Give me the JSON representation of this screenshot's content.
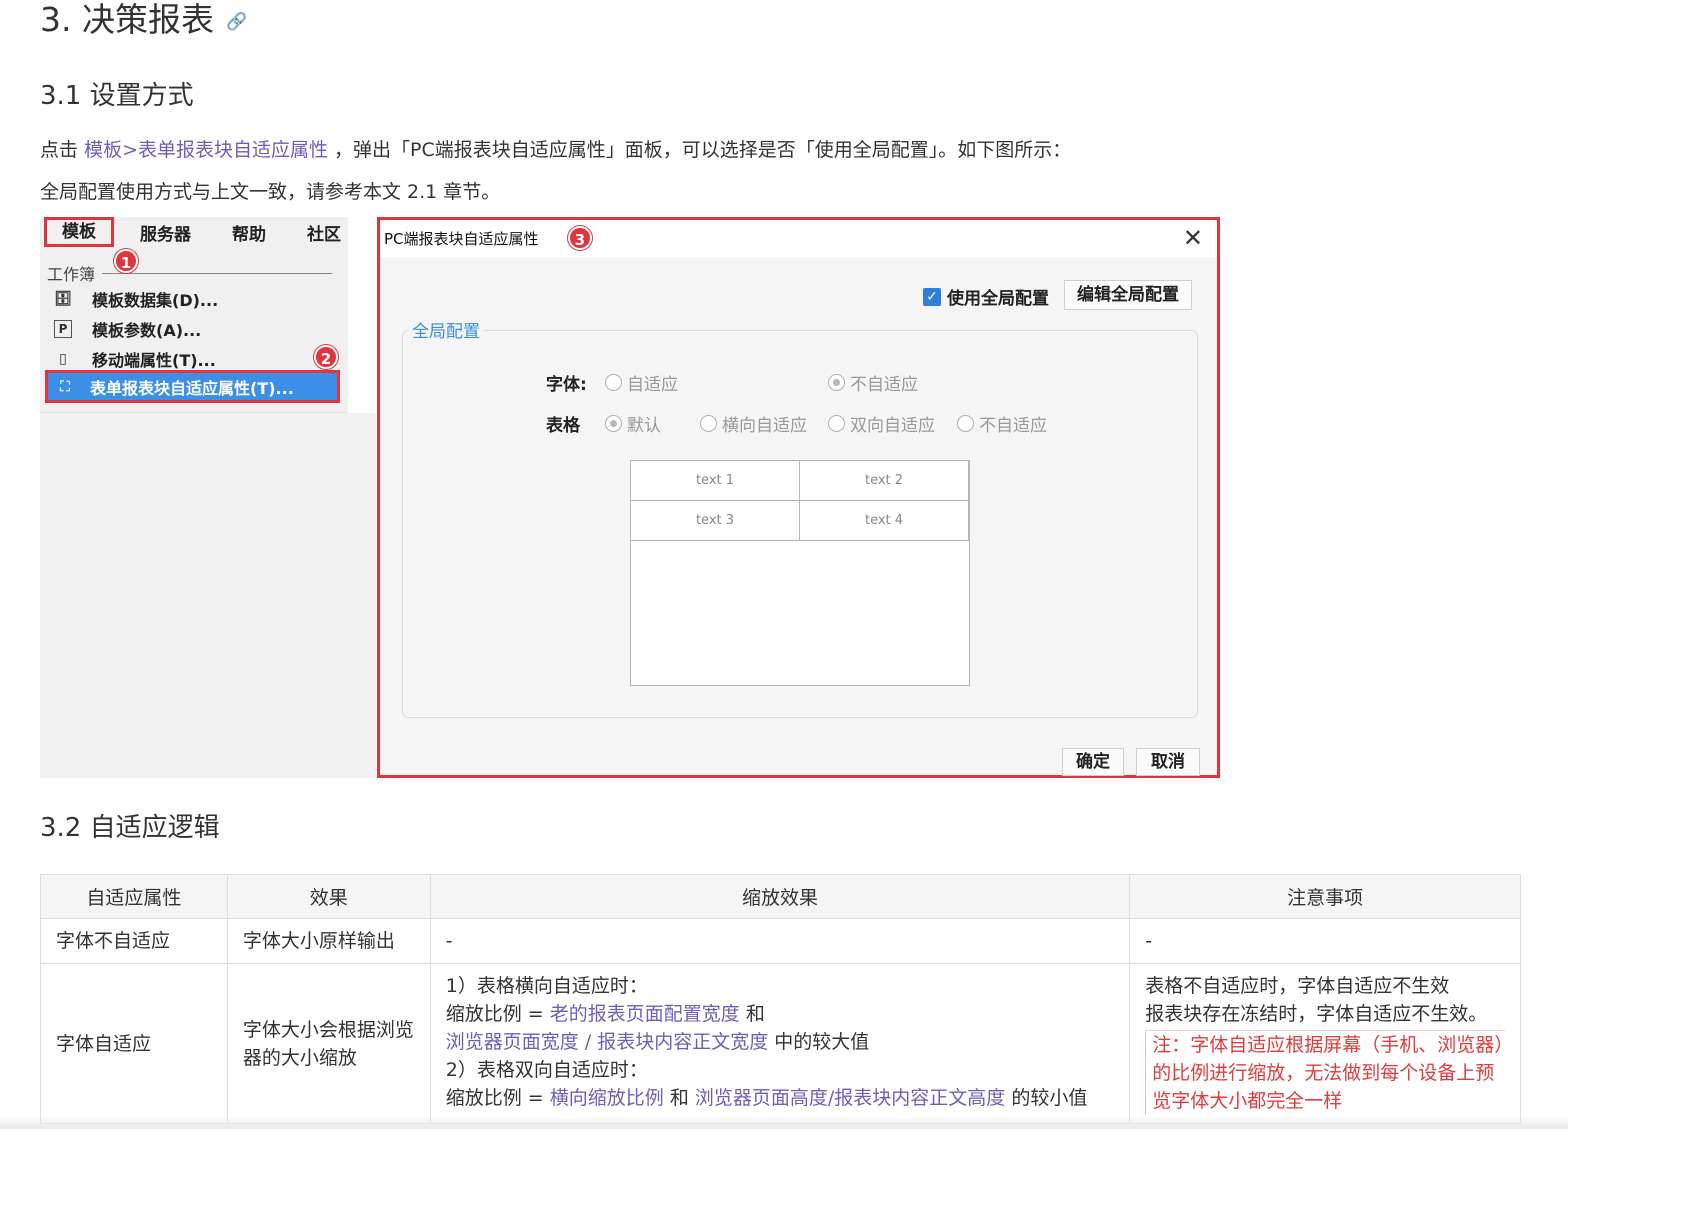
{
  "heading": {
    "title": "3. 决策报表",
    "anchor_icon": "🔗"
  },
  "section_31": {
    "title": "3.1 设置方式",
    "para1_prefix": "点击",
    "para1_link": "模板>表单报表块自适应属性",
    "para1_suffix": "，弹出「PC端报表块自适应属性」面板，可以选择是否「使用全局配置」。如下图所示：",
    "para2": "全局配置使用方式与上文一致，请参考本文 2.1 章节。"
  },
  "menu": {
    "bar": [
      "模板",
      "服务器",
      "帮助",
      "社区"
    ],
    "workbook_label": "工作簿",
    "items": [
      {
        "icon": "database-icon",
        "glyph": "🗄",
        "label": "模板数据集(D)..."
      },
      {
        "icon": "parameter-icon",
        "glyph": "P",
        "label": "模板参数(A)..."
      },
      {
        "icon": "mobile-icon",
        "glyph": "▯",
        "label": "移动端属性(T)..."
      },
      {
        "icon": "adaptive-icon",
        "glyph": "⛶",
        "label": "表单报表块自适应属性(T)..."
      }
    ],
    "badges": [
      "1",
      "2"
    ]
  },
  "dialog": {
    "title": "PC端报表块自适应属性",
    "badge": "3",
    "close_glyph": "✕",
    "use_global_label": "使用全局配置",
    "use_global_checked": true,
    "edit_global_button": "编辑全局配置",
    "group_title": "全局配置",
    "font_label": "字体:",
    "font_options": [
      "自适应",
      "不自适应"
    ],
    "font_selected": "不自适应",
    "table_label": "表格",
    "table_options": [
      "默认",
      "横向自适应",
      "双向自适应",
      "不自适应"
    ],
    "table_selected": "默认",
    "preview_cells": [
      "text 1",
      "text 2",
      "text 3",
      "text 4"
    ],
    "ok_button": "确定",
    "cancel_button": "取消"
  },
  "section_32": {
    "title": "3.2 自适应逻辑",
    "table": {
      "headers": [
        "自适应属性",
        "效果",
        "缩放效果",
        "注意事项"
      ],
      "row1": {
        "prop": "字体不自适应",
        "effect": "字体大小原样输出",
        "zoom": "-",
        "note": "-"
      },
      "row2": {
        "prop": "字体自适应",
        "effect": "字体大小会根据浏览器的大小缩放",
        "zoom_line1": "1）表格横向自适应时：",
        "zoom_line2_prefix": "缩放比例 =",
        "zoom_line2_link": "老的报表页面配置宽度",
        "zoom_line2_suffix": "和",
        "zoom_line3_link": "浏览器页面宽度 / 报表块内容正文宽度",
        "zoom_line3_suffix": "中的较大值",
        "zoom_line4": "2）表格双向自适应时：",
        "zoom_line5_prefix": "缩放比例 =",
        "zoom_line5_link1": "横向缩放比例",
        "zoom_line5_mid": "和",
        "zoom_line5_link2": "浏览器页面高度/报表块内容正文高度",
        "zoom_line5_suffix": "的较小值",
        "note_line1": "表格不自适应时，字体自适应不生效",
        "note_line2": "报表块存在冻结时，字体自适应不生效。",
        "note_red": "注：字体自适应根据屏幕（手机、浏览器）的比例进行缩放，无法做到每个设备上预览字体大小都完全一样"
      }
    }
  }
}
